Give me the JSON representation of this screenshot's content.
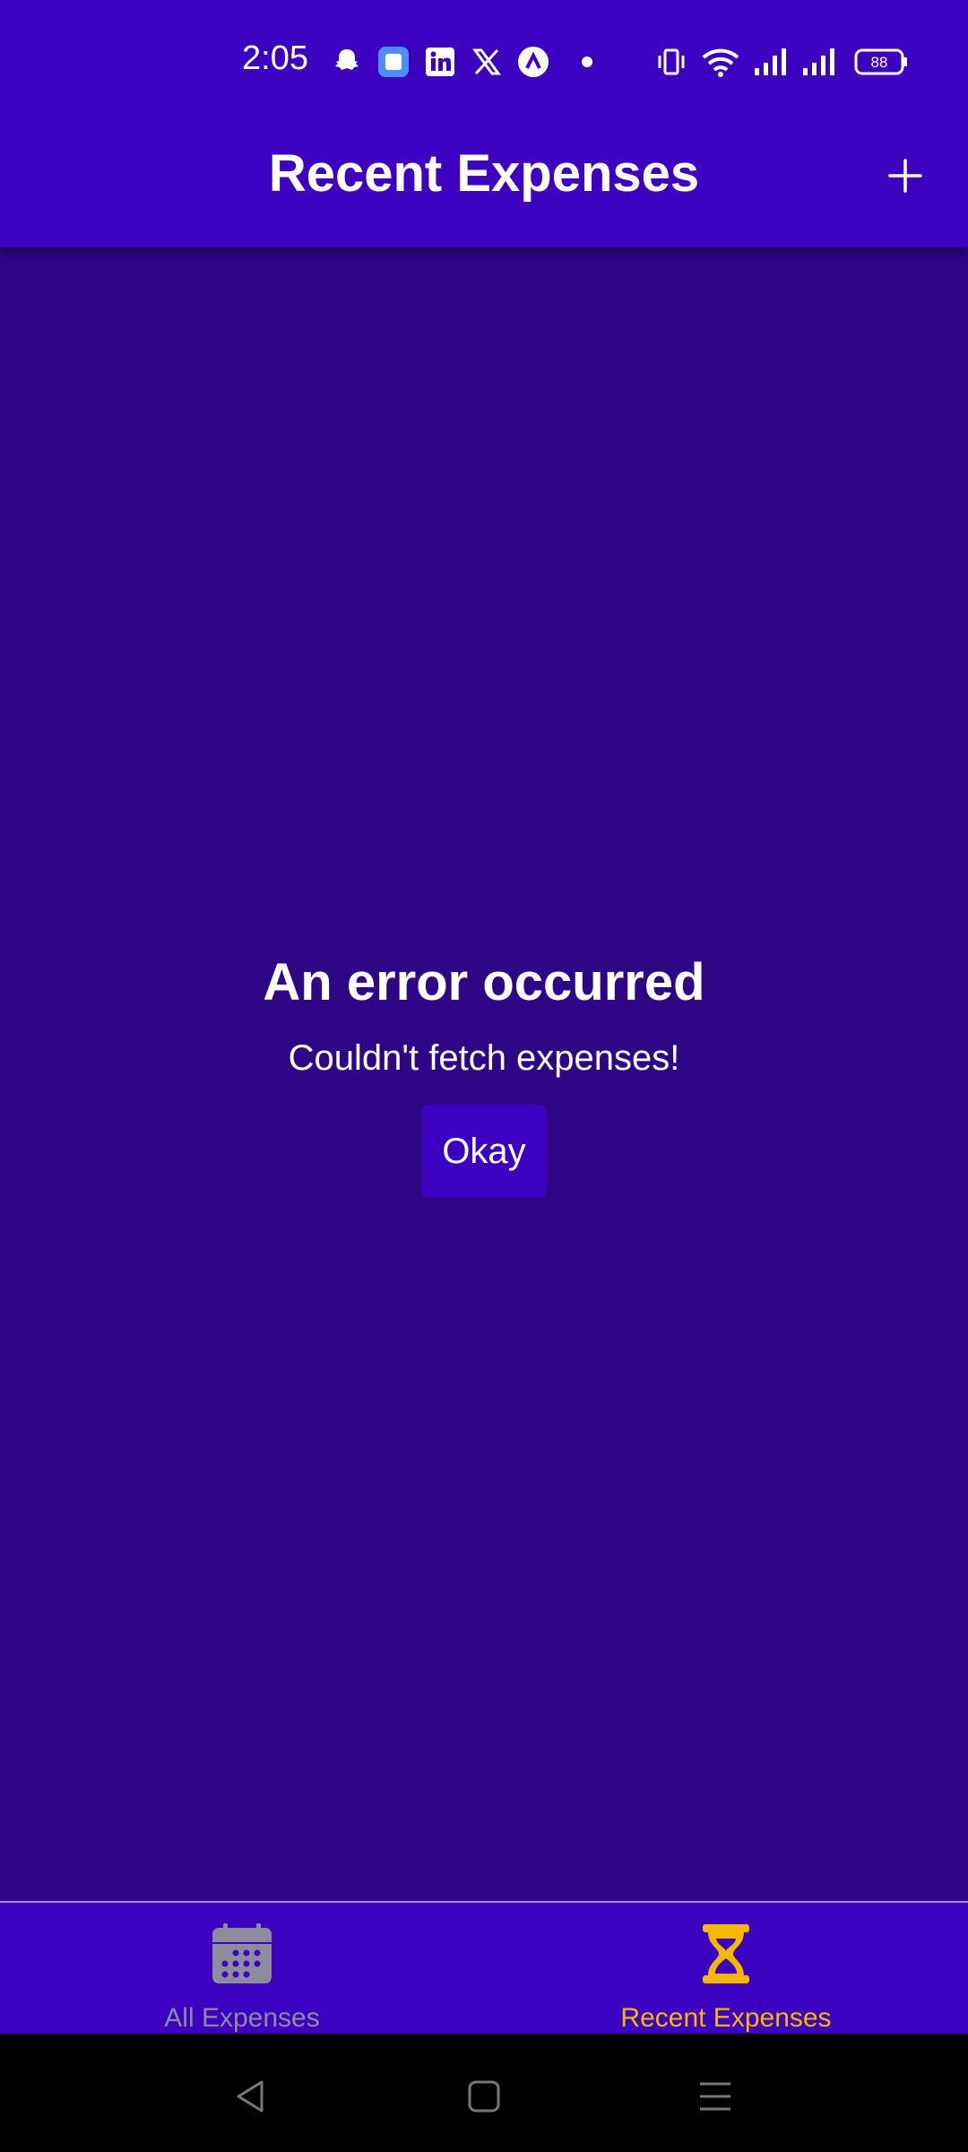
{
  "status_bar": {
    "time": "2:05",
    "battery": "88",
    "icons": [
      "snapchat-icon",
      "app-icon",
      "linkedin-icon",
      "x-icon",
      "arc-icon",
      "dot-icon",
      "vibrate-icon",
      "wifi-icon",
      "signal-icon",
      "signal-icon",
      "battery-icon"
    ]
  },
  "header": {
    "title": "Recent Expenses",
    "add_icon": "plus-icon"
  },
  "error": {
    "title": "An error occurred",
    "message": "Couldn't fetch expenses!",
    "button_label": "Okay"
  },
  "tabs": [
    {
      "label": "All Expenses",
      "icon": "calendar-icon",
      "active": false,
      "color": "#8c8c9c"
    },
    {
      "label": "Recent Expenses",
      "icon": "hourglass-icon",
      "active": true,
      "color": "#f5b800"
    }
  ],
  "colors": {
    "primary": "#3d02c0",
    "background": "#2e0787",
    "accent": "#f5b800"
  }
}
